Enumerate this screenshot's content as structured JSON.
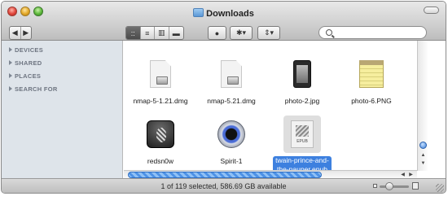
{
  "window": {
    "title": "Downloads"
  },
  "toolbar": {
    "back_label": "◀",
    "forward_label": "▶",
    "view_buttons": [
      "::",
      "≡",
      "▥",
      "▬"
    ],
    "active_view_index": 0,
    "quicklook_label": "●",
    "action_label": "✱▾",
    "arrange_label": "⇕▾",
    "search": {
      "placeholder": "",
      "value": ""
    }
  },
  "sidebar": {
    "sections": [
      "DEVICES",
      "SHARED",
      "PLACES",
      "SEARCH FOR"
    ]
  },
  "files": [
    {
      "name": "nmap-5-1.21.dmg",
      "icon": "disk-image-icon",
      "selected": false
    },
    {
      "name": "nmap-5.21.dmg",
      "icon": "disk-image-icon",
      "selected": false
    },
    {
      "name": "photo-2.jpg",
      "icon": "photo-icon",
      "selected": false
    },
    {
      "name": "photo-6.PNG",
      "icon": "notes-image-icon",
      "selected": false
    },
    {
      "name": "redsn0w",
      "icon": "pineapple-app-icon",
      "selected": false
    },
    {
      "name": "Spirit-1",
      "icon": "spirit-app-icon",
      "selected": false
    },
    {
      "name_line1": "twain-prince-and-",
      "name_line2": "the-pauper.epub",
      "icon": "epub-document-icon",
      "selected": true,
      "badge": "EPUB"
    }
  ],
  "status": {
    "text": "1 of 119 selected, 586.69 GB available"
  },
  "colors": {
    "selection": "#3d80df",
    "sidebar_bg": "#dee4ea"
  }
}
